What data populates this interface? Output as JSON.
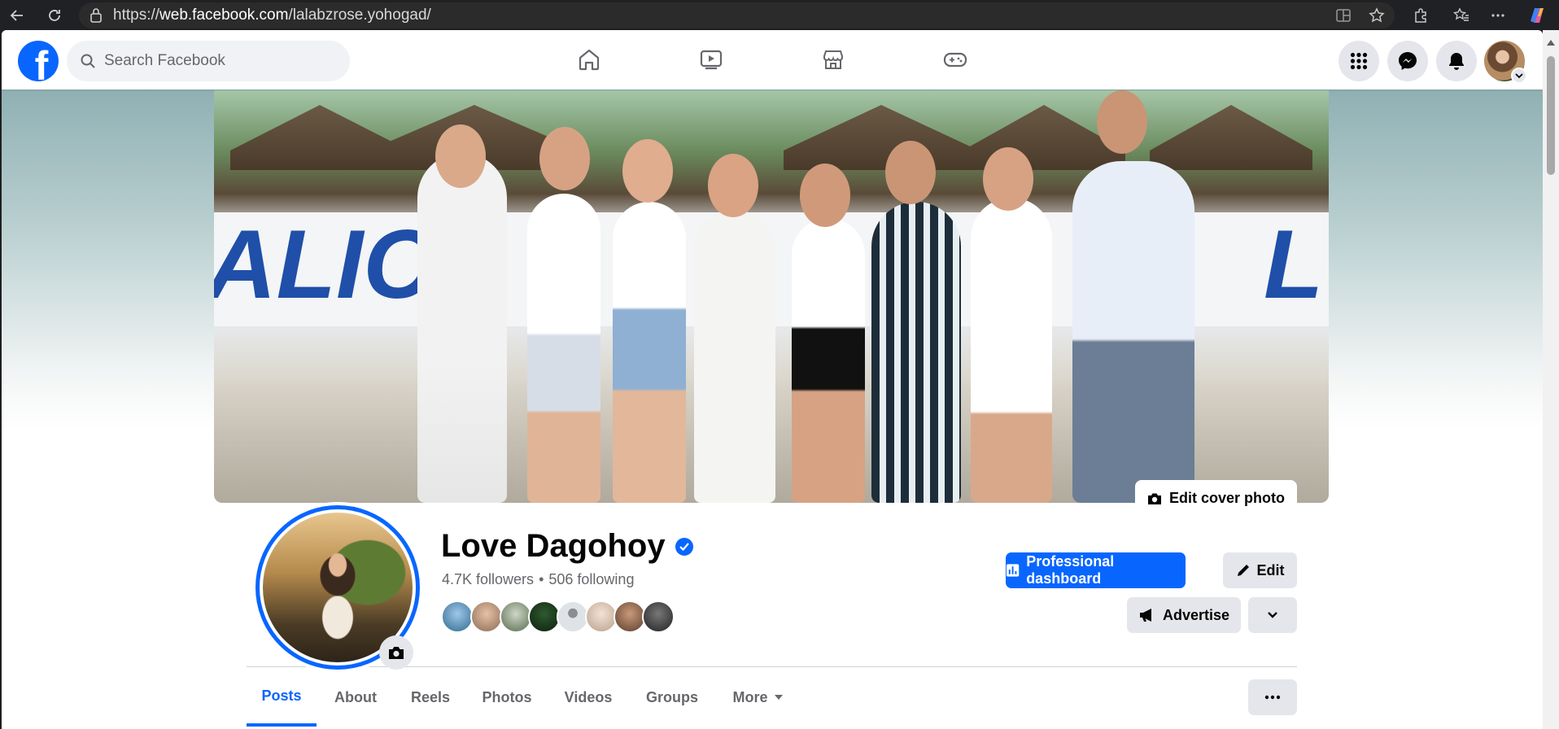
{
  "browser": {
    "url_prefix": "https://",
    "url_host": "web.facebook.com",
    "url_path": "/lalabzrose.yohogad/",
    "icons": [
      "back-arrow-icon",
      "reload-icon",
      "lock-icon",
      "split-screen-icon",
      "favorite-star-icon",
      "extensions-icon",
      "favorites-icon",
      "more-icon",
      "copilot-icon"
    ]
  },
  "fb_nav": {
    "logo": "f",
    "search_placeholder": "Search Facebook",
    "tabs": [
      "home-icon",
      "video-icon",
      "marketplace-icon",
      "gaming-icon"
    ],
    "right_icons": [
      "menu-grid-icon",
      "messenger-icon",
      "notifications-bell-icon",
      "account-avatar"
    ]
  },
  "cover": {
    "edit_label": "Edit cover photo",
    "wall_text": [
      "ALIC",
      "L"
    ]
  },
  "profile": {
    "name": "Love Dagohoy",
    "followers": "4.7K followers",
    "separator": "•",
    "following": "506 following",
    "verified": true
  },
  "actions": {
    "dashboard_label": "Professional dashboard",
    "edit_label": "Edit",
    "advertise_label": "Advertise"
  },
  "tabs": [
    {
      "label": "Posts",
      "active": true
    },
    {
      "label": "About",
      "active": false
    },
    {
      "label": "Reels",
      "active": false
    },
    {
      "label": "Photos",
      "active": false
    },
    {
      "label": "Videos",
      "active": false
    },
    {
      "label": "Groups",
      "active": false
    },
    {
      "label": "More",
      "active": false
    }
  ],
  "colors": {
    "brand_blue": "#0866ff",
    "button_gray": "#e4e6eb",
    "text_primary": "#050505",
    "text_secondary": "#65676b"
  }
}
